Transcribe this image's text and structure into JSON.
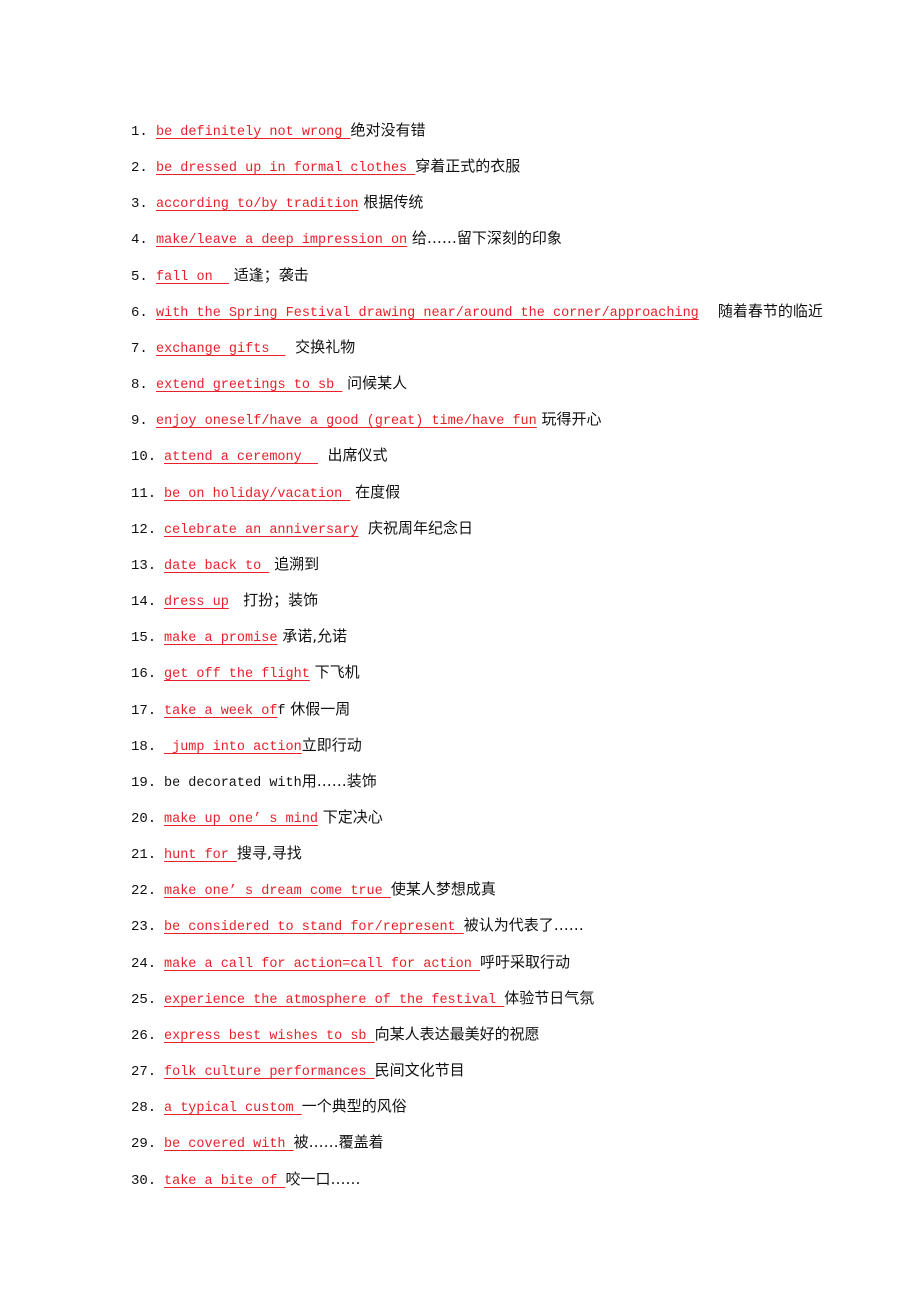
{
  "items": [
    {
      "num": "1.",
      "en": "be definitely not wrong ",
      "tail": "",
      "zh": "绝对没有错"
    },
    {
      "num": "2.",
      "en": "be dressed up in formal clothes ",
      "tail": "",
      "zh": "穿着正式的衣服"
    },
    {
      "num": "3.",
      "en": "according to/by tradition",
      "tail": "",
      "zh": " 根据传统"
    },
    {
      "num": "4.",
      "en": "make/leave a deep impression on",
      "tail": "",
      "zh": " 给……留下深刻的印象"
    },
    {
      "num": "5.",
      "en": "fall on  ",
      "tail": "",
      "zh": " 适逢；袭击"
    },
    {
      "num": "6.",
      "en": "with the Spring Festival drawing near/around the corner/approaching",
      "tail": "",
      "zh": "    随着春节的临近"
    },
    {
      "num": "7.",
      "en": "exchange gifts  ",
      "tail": "",
      "zh": "  交换礼物"
    },
    {
      "num": "8.",
      "en": "extend greetings to sb ",
      "tail": "",
      "zh": " 问候某人"
    },
    {
      "num": "9.",
      "en": "enjoy oneself/have a good (great) time/have fun",
      "tail": "",
      "zh": " 玩得开心"
    },
    {
      "num": "10.",
      "en": "attend a ceremony  ",
      "tail": "",
      "zh": "  出席仪式"
    },
    {
      "num": "11.",
      "en": "be on holiday/vacation ",
      "tail": "",
      "zh": " 在度假"
    },
    {
      "num": "12.",
      "en": "celebrate an anniversary",
      "tail": "",
      "zh": "  庆祝周年纪念日"
    },
    {
      "num": "13.",
      "en": "date back to ",
      "tail": "",
      "zh": " 追溯到"
    },
    {
      "num": "14.",
      "en": "dress up",
      "tail": "",
      "zh": "   打扮；装饰"
    },
    {
      "num": "15.",
      "en": "make a promise",
      "tail": "",
      "zh": " 承诺,允诺"
    },
    {
      "num": "16.",
      "en": "get off the flight",
      "tail": "",
      "zh": " 下飞机"
    },
    {
      "num": "17.",
      "en": "take a week of",
      "tail": "f",
      "zh": " 休假一周"
    },
    {
      "num": "18.",
      "en": " jump into action",
      "tail": "",
      "zh": "立即行动"
    },
    {
      "num": "19.",
      "en": "be decorated with",
      "tail": "",
      "zh": "用……装饰",
      "plain": true
    },
    {
      "num": "20.",
      "en": "make up one’ s mind",
      "tail": "",
      "zh": " 下定决心"
    },
    {
      "num": "21.",
      "en": "hunt for ",
      "tail": "",
      "zh": "搜寻,寻找"
    },
    {
      "num": "22.",
      "en": "make one’ s dream come true ",
      "tail": "",
      "zh": "使某人梦想成真"
    },
    {
      "num": "23.",
      "en": "be considered to stand for/represent ",
      "tail": "",
      "zh": "被认为代表了……"
    },
    {
      "num": "24.",
      "en": "make a call for action=call for action ",
      "tail": "",
      "zh": "呼吁采取行动"
    },
    {
      "num": "25.",
      "en": "experience the atmosphere of the festival ",
      "tail": "",
      "zh": "体验节日气氛"
    },
    {
      "num": "26.",
      "en": "express best wishes to sb ",
      "tail": "",
      "zh": "向某人表达最美好的祝愿"
    },
    {
      "num": "27.",
      "en": "folk culture performances ",
      "tail": "",
      "zh": "民间文化节目"
    },
    {
      "num": "28.",
      "en": "a typical custom ",
      "tail": "",
      "zh": "一个典型的风俗"
    },
    {
      "num": "29.",
      "en": "be covered with ",
      "tail": "",
      "zh": "被……覆盖着"
    },
    {
      "num": "30.",
      "en": "take a bite of ",
      "tail": "",
      "zh": "咬一口……"
    }
  ],
  "colors": {
    "phrase": "#e8202a",
    "text": "#111111"
  }
}
